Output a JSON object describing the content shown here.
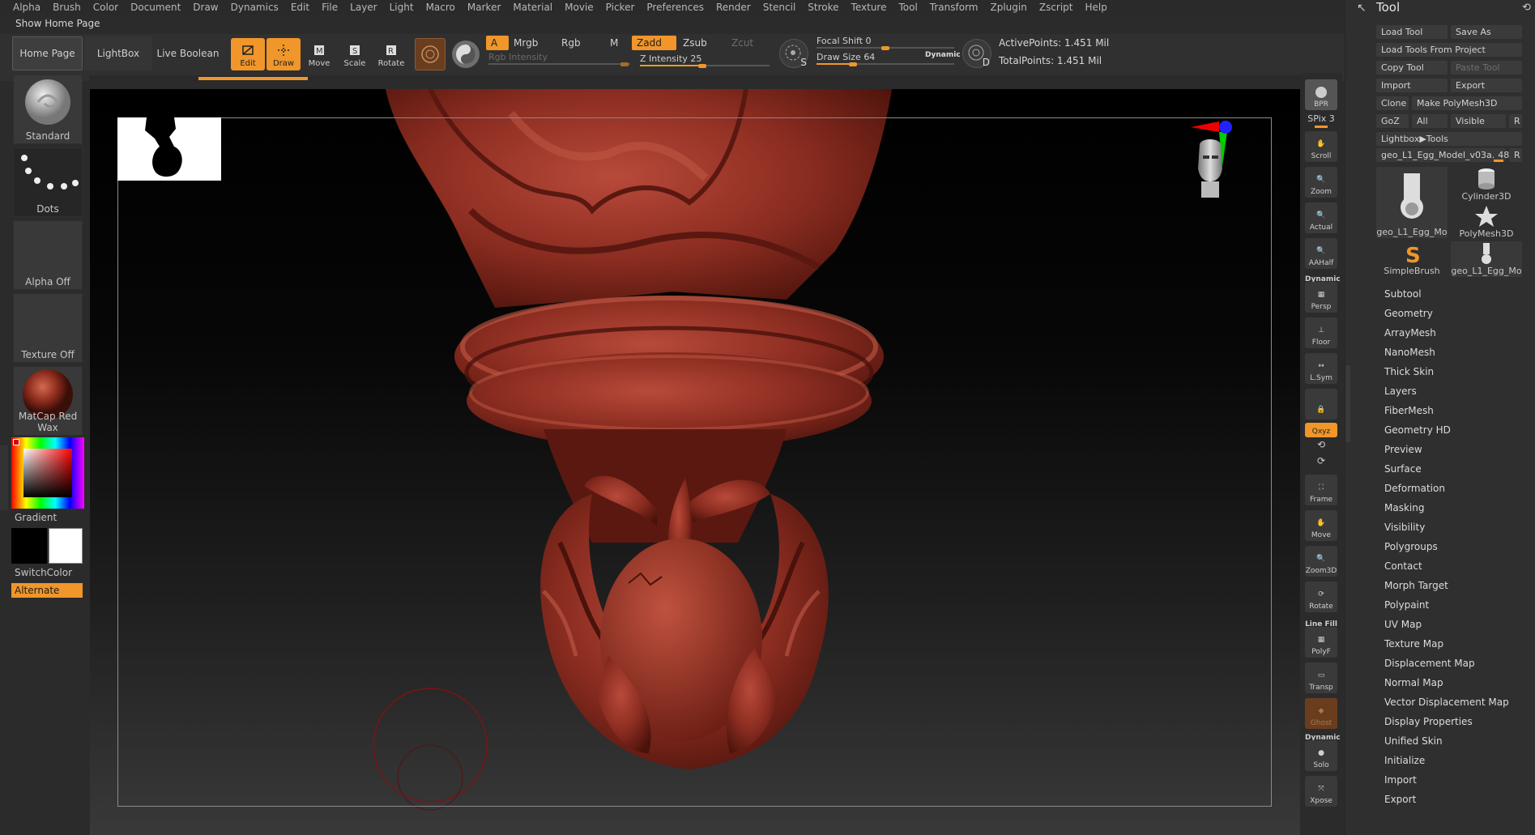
{
  "menubar": [
    "Alpha",
    "Brush",
    "Color",
    "Document",
    "Draw",
    "Dynamics",
    "Edit",
    "File",
    "Layer",
    "Light",
    "Macro",
    "Marker",
    "Material",
    "Movie",
    "Picker",
    "Preferences",
    "Render",
    "Stencil",
    "Stroke",
    "Texture",
    "Tool",
    "Transform",
    "Zplugin",
    "Zscript",
    "Help"
  ],
  "home_label": "Show Home Page",
  "toolbar": {
    "tabs": {
      "home": "Home Page",
      "lightbox": "LightBox",
      "live_boolean": "Live Boolean"
    },
    "edit": "Edit",
    "draw": "Draw",
    "move": "Move",
    "scale": "Scale",
    "rotate": "Rotate",
    "a": "A",
    "mrgb": "Mrgb",
    "rgb": "Rgb",
    "m": "M",
    "zadd": "Zadd",
    "zsub": "Zsub",
    "zcut": "Zcut",
    "rgb_intensity": "Rgb Intensity",
    "z_intensity_label": "Z Intensity",
    "z_intensity": "25",
    "focal_shift_label": "Focal Shift",
    "focal_shift": "0",
    "draw_size_label": "Draw Size",
    "draw_size": "64",
    "dynamic": "Dynamic",
    "s_key": "S",
    "d_key": "D",
    "active_points": "ActivePoints: 1.451 Mil",
    "total_points": "TotalPoints: 1.451 Mil"
  },
  "left_shelf": {
    "brush": "Standard",
    "stroke": "Dots",
    "alpha": "Alpha Off",
    "texture": "Texture Off",
    "material": "MatCap Red Wax",
    "gradient": "Gradient",
    "switch_color": "SwitchColor",
    "alternate": "Alternate"
  },
  "right_shelf": {
    "bpr": "BPR",
    "spix": "SPix 3",
    "scroll": "Scroll",
    "zoom": "Zoom",
    "actual": "Actual",
    "aahalf": "AAHalf",
    "dynamic": "Dynamic",
    "persp": "Persp",
    "floor": "Floor",
    "lsym": "L.Sym",
    "xyz": "Qxyz",
    "frame": "Frame",
    "move": "Move",
    "zoom3d": "Zoom3D",
    "rotate": "Rotate",
    "linefill": "Line Fill",
    "polyf": "PolyF",
    "transp": "Transp",
    "ghost": "Ghost",
    "dynamic2": "Dynamic",
    "solo": "Solo",
    "xpose": "Xpose"
  },
  "tool_panel": {
    "title": "Tool",
    "load_tool": "Load Tool",
    "save_as": "Save As",
    "load_from_project": "Load Tools From Project",
    "copy_tool": "Copy Tool",
    "paste_tool": "Paste Tool",
    "import": "Import",
    "export": "Export",
    "clone": "Clone",
    "make_polymesh": "Make PolyMesh3D",
    "goz": "GoZ",
    "all": "All",
    "visible": "Visible",
    "r": "R",
    "lightbox_tools": "Lightbox▶Tools",
    "current_tool": "geo_L1_Egg_Model_v03a.",
    "current_count": "48",
    "tiles": [
      "geo_L1_Egg_Mo",
      "Cylinder3D",
      "PolyMesh3D",
      "SimpleBrush",
      "geo_L1_Egg_Mo"
    ],
    "sections": [
      "Subtool",
      "Geometry",
      "ArrayMesh",
      "NanoMesh",
      "Thick Skin",
      "Layers",
      "FiberMesh",
      "Geometry HD",
      "Preview",
      "Surface",
      "Deformation",
      "Masking",
      "Visibility",
      "Polygroups",
      "Contact",
      "Morph Target",
      "Polypaint",
      "UV Map",
      "Texture Map",
      "Displacement Map",
      "Normal Map",
      "Vector Displacement Map",
      "Display Properties",
      "Unified Skin",
      "Initialize",
      "Import",
      "Export"
    ]
  },
  "colors": {
    "accent": "#f0962a",
    "model": "#8b2f22",
    "panel": "#2f2f2f"
  }
}
